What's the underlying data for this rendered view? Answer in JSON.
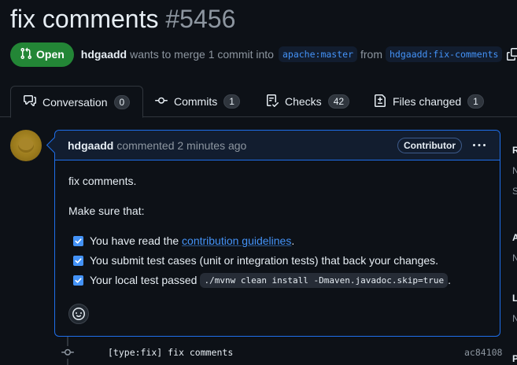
{
  "pr": {
    "title": "fix comments",
    "number": "#5456",
    "state": "Open",
    "author": "hdgaadd",
    "merge_text": "wants to merge 1 commit into",
    "base_branch": "apache:master",
    "from_text": "from",
    "head_branch": "hdgaadd:fix-comments"
  },
  "tabs": [
    {
      "label": "Conversation",
      "count": "0",
      "icon": "comment-discussion-icon"
    },
    {
      "label": "Commits",
      "count": "1",
      "icon": "git-commit-icon"
    },
    {
      "label": "Checks",
      "count": "42",
      "icon": "checklist-icon"
    },
    {
      "label": "Files changed",
      "count": "1",
      "icon": "file-diff-icon"
    }
  ],
  "comment": {
    "author": "hdgaadd",
    "action": "commented 2 minutes ago",
    "badge": "Contributor",
    "body_line1": "fix comments.",
    "body_line2": "Make sure that:",
    "tasks": [
      {
        "pre": "You have read the ",
        "link": "contribution guidelines",
        "post": ".",
        "checked": true
      },
      {
        "text": "You submit test cases (unit or integration tests) that back your changes.",
        "checked": true
      },
      {
        "text": "Your local test passed",
        "code": "./mvnw clean install -Dmaven.javadoc.skip=true",
        "post": ".",
        "checked": true
      }
    ]
  },
  "commit": {
    "message": "[type:fix] fix comments",
    "sha": "ac84108"
  },
  "sidebar_letters": [
    "R",
    "N",
    "S",
    "A",
    "N",
    "L",
    "N",
    "P"
  ],
  "colors": {
    "background": "#0d1117",
    "open_green": "#238636",
    "accent_blue": "#4493f8",
    "comment_border": "#1f6feb"
  }
}
